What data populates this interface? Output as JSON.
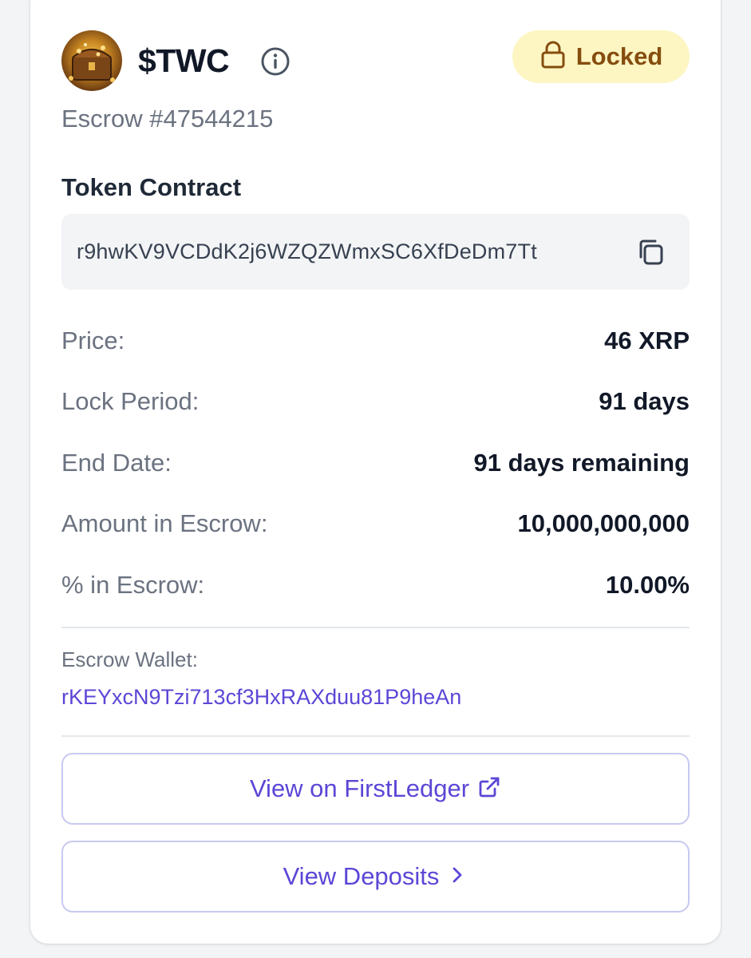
{
  "token": {
    "symbol": "$TWC",
    "escrow_id": "Escrow #47544215"
  },
  "status_badge": {
    "label": "Locked",
    "icon": "lock-icon",
    "bg_color": "#fdf6c3",
    "text_color": "#854d0e"
  },
  "contract": {
    "label": "Token Contract",
    "address": "r9hwKV9VCDdK2j6WZQZWmxSC6XfDeDm7Tt",
    "copy_icon": "copy-icon"
  },
  "details": [
    {
      "label": "Price:",
      "value": "46 XRP"
    },
    {
      "label": "Lock Period:",
      "value": "91 days"
    },
    {
      "label": "End Date:",
      "value": "91 days remaining"
    },
    {
      "label": "Amount in Escrow:",
      "value": "10,000,000,000"
    },
    {
      "label": "% in Escrow:",
      "value": "10.00%"
    }
  ],
  "wallet": {
    "label": "Escrow Wallet:",
    "address": "rKEYxcN9Tzi713cf3HxRAXduu81P9heAn"
  },
  "buttons": {
    "firstledger": {
      "label": "View on FirstLedger",
      "icon": "external-link-icon"
    },
    "deposits": {
      "label": "View Deposits",
      "icon": "chevron-right-icon"
    }
  },
  "colors": {
    "accent": "#5b47d6",
    "muted_text": "#6b7280",
    "primary_text": "#111827"
  }
}
